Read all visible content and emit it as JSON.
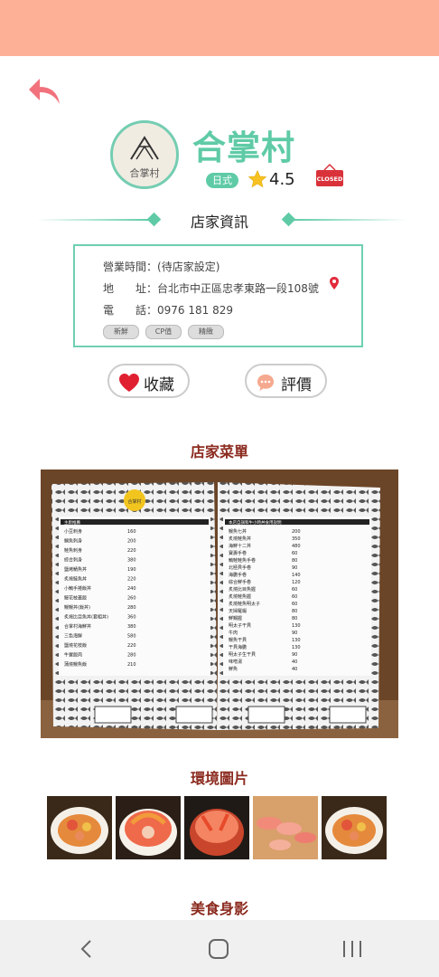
{
  "shop": {
    "name": "合掌村",
    "logo_text": "合掌村",
    "cuisine": "日式",
    "rating": "4.5",
    "status_icon_text": "CLOSED"
  },
  "info": {
    "section_title": "店家資訊",
    "hours_label": "營業時間：",
    "hours_value": "(待店家設定)",
    "address_label": "地　　址：",
    "address_value": "台北市中正區忠孝東路一段108號",
    "phone_label": "電　　話：",
    "phone_value": "0976 181 829",
    "tags": [
      "新鮮",
      "CP值",
      "精緻"
    ]
  },
  "actions": {
    "favorite_label": "收藏",
    "review_label": "評價"
  },
  "sections": {
    "menu_title": "店家菜單",
    "environment_title": "環境圖片",
    "food_title": "美食身影"
  },
  "menu_photo": {
    "logo_text": "合掌村",
    "left_header": "主廚推薦",
    "right_header": "本店自調和牛小時丼食用說明",
    "left_items": [
      [
        "小豆刺身",
        "160"
      ],
      [
        "鯛魚刺身",
        "200"
      ],
      [
        "鮭魚刺身",
        "220"
      ],
      [
        "綜合刺身",
        "380"
      ],
      [
        "鹽烤鯖魚丼",
        "190"
      ],
      [
        "炙燒鮭魚丼",
        "220"
      ],
      [
        "小鮪手捲飯丼",
        "240"
      ],
      [
        "鰻花枝蓋飯",
        "260"
      ],
      [
        "鰻鰻丼(飯丼)",
        "280"
      ],
      [
        "炙燒比目魚丼(套組丼)",
        "360"
      ],
      [
        "合掌村海鮮丼",
        "380"
      ],
      [
        "三色海鮮",
        "580"
      ],
      [
        "鹽燒花枝飯",
        "220"
      ],
      [
        "牛寶飯肉",
        "280"
      ],
      [
        "蒲燒鰻魚飯",
        "210"
      ]
    ],
    "right_items": [
      [
        "鰻魚七丼",
        "200"
      ],
      [
        "炙燒鮭魚丼",
        "350"
      ],
      [
        "海鮮十二丼",
        "480"
      ],
      [
        "寶壽手卷",
        "60"
      ],
      [
        "鮪鮭鮭魚手卷",
        "80"
      ],
      [
        "北極貝手卷",
        "90"
      ],
      [
        "海膽手卷",
        "140"
      ],
      [
        "綜合鮮手卷",
        "120"
      ],
      [
        "炙燒比目魚握",
        "60"
      ],
      [
        "炙燒鮭魚握",
        "60"
      ],
      [
        "炙燒鮭魚明太子",
        "60"
      ],
      [
        "天婦羅蝦",
        "80"
      ],
      [
        "鮮鯛握",
        "80"
      ],
      [
        "明太子干貝",
        "130"
      ],
      [
        "牛肉",
        "90"
      ],
      [
        "鰻魚干貝",
        "130"
      ],
      [
        "干貝海膽",
        "130"
      ],
      [
        "明太子生干貝",
        "90"
      ],
      [
        "味噌湯",
        "40"
      ],
      [
        "鮮魚",
        "40"
      ]
    ]
  },
  "colors": {
    "accent": "#5fcba6",
    "topbar": "#fdb096",
    "section_heading": "#8b2a1e",
    "back_arrow": "#f1727c",
    "favorite_heart": "#e02030",
    "closed_sign": "#d9323a"
  },
  "icons": {
    "back": "undo-arrow-icon",
    "logo": "roof-logo-icon",
    "rating": "star-icon",
    "status": "closed-sign-icon",
    "address": "location-pin-icon",
    "favorite": "heart-icon",
    "review": "speech-bubble-icon",
    "nav_back": "chevron-left-icon",
    "nav_home": "home-square-icon",
    "nav_recent": "recent-apps-icon"
  }
}
